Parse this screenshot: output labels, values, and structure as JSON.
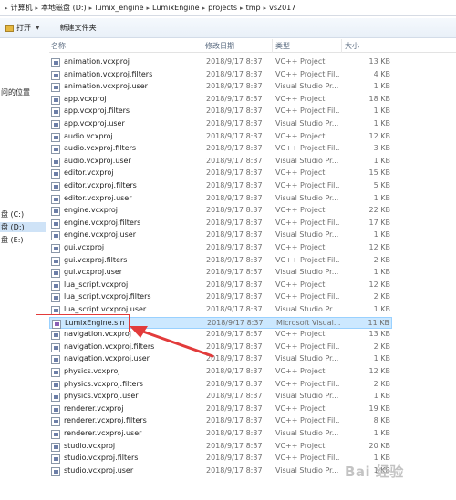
{
  "breadcrumb": [
    "计算机",
    "本地磁盘 (D:)",
    "lumix_engine",
    "LumixEngine",
    "projects",
    "tmp",
    "vs2017"
  ],
  "toolbar": {
    "open_label": "打开",
    "new_folder_label": "新建文件夹"
  },
  "nav": {
    "location_label": "问的位置",
    "drive_c": "盘 (C:)",
    "drive_d": "盘 (D:)",
    "drive_e": "盘 (E:)"
  },
  "columns": {
    "name": "名称",
    "date": "修改日期",
    "type": "类型",
    "size": "大小"
  },
  "files": [
    {
      "name": "animation.vcxproj",
      "date": "2018/9/17 8:37",
      "type": "VC++ Project",
      "size": "13 KB"
    },
    {
      "name": "animation.vcxproj.filters",
      "date": "2018/9/17 8:37",
      "type": "VC++ Project Fil...",
      "size": "4 KB"
    },
    {
      "name": "animation.vcxproj.user",
      "date": "2018/9/17 8:37",
      "type": "Visual Studio Pr...",
      "size": "1 KB"
    },
    {
      "name": "app.vcxproj",
      "date": "2018/9/17 8:37",
      "type": "VC++ Project",
      "size": "18 KB"
    },
    {
      "name": "app.vcxproj.filters",
      "date": "2018/9/17 8:37",
      "type": "VC++ Project Fil...",
      "size": "1 KB"
    },
    {
      "name": "app.vcxproj.user",
      "date": "2018/9/17 8:37",
      "type": "Visual Studio Pr...",
      "size": "1 KB"
    },
    {
      "name": "audio.vcxproj",
      "date": "2018/9/17 8:37",
      "type": "VC++ Project",
      "size": "12 KB"
    },
    {
      "name": "audio.vcxproj.filters",
      "date": "2018/9/17 8:37",
      "type": "VC++ Project Fil...",
      "size": "3 KB"
    },
    {
      "name": "audio.vcxproj.user",
      "date": "2018/9/17 8:37",
      "type": "Visual Studio Pr...",
      "size": "1 KB"
    },
    {
      "name": "editor.vcxproj",
      "date": "2018/9/17 8:37",
      "type": "VC++ Project",
      "size": "15 KB"
    },
    {
      "name": "editor.vcxproj.filters",
      "date": "2018/9/17 8:37",
      "type": "VC++ Project Fil...",
      "size": "5 KB"
    },
    {
      "name": "editor.vcxproj.user",
      "date": "2018/9/17 8:37",
      "type": "Visual Studio Pr...",
      "size": "1 KB"
    },
    {
      "name": "engine.vcxproj",
      "date": "2018/9/17 8:37",
      "type": "VC++ Project",
      "size": "22 KB"
    },
    {
      "name": "engine.vcxproj.filters",
      "date": "2018/9/17 8:37",
      "type": "VC++ Project Fil...",
      "size": "17 KB"
    },
    {
      "name": "engine.vcxproj.user",
      "date": "2018/9/17 8:37",
      "type": "Visual Studio Pr...",
      "size": "1 KB"
    },
    {
      "name": "gui.vcxproj",
      "date": "2018/9/17 8:37",
      "type": "VC++ Project",
      "size": "12 KB"
    },
    {
      "name": "gui.vcxproj.filters",
      "date": "2018/9/17 8:37",
      "type": "VC++ Project Fil...",
      "size": "2 KB"
    },
    {
      "name": "gui.vcxproj.user",
      "date": "2018/9/17 8:37",
      "type": "Visual Studio Pr...",
      "size": "1 KB"
    },
    {
      "name": "lua_script.vcxproj",
      "date": "2018/9/17 8:37",
      "type": "VC++ Project",
      "size": "12 KB"
    },
    {
      "name": "lua_script.vcxproj.filters",
      "date": "2018/9/17 8:37",
      "type": "VC++ Project Fil...",
      "size": "2 KB"
    },
    {
      "name": "lua_script.vcxproj.user",
      "date": "2018/9/17 8:37",
      "type": "Visual Studio Pr...",
      "size": "1 KB"
    },
    {
      "name": "LumixEngine.sln",
      "date": "2018/9/17 8:37",
      "type": "Microsoft Visual...",
      "size": "11 KB"
    },
    {
      "name": "navigation.vcxproj",
      "date": "2018/9/17 8:37",
      "type": "VC++ Project",
      "size": "13 KB"
    },
    {
      "name": "navigation.vcxproj.filters",
      "date": "2018/9/17 8:37",
      "type": "VC++ Project Fil...",
      "size": "2 KB"
    },
    {
      "name": "navigation.vcxproj.user",
      "date": "2018/9/17 8:37",
      "type": "Visual Studio Pr...",
      "size": "1 KB"
    },
    {
      "name": "physics.vcxproj",
      "date": "2018/9/17 8:37",
      "type": "VC++ Project",
      "size": "12 KB"
    },
    {
      "name": "physics.vcxproj.filters",
      "date": "2018/9/17 8:37",
      "type": "VC++ Project Fil...",
      "size": "2 KB"
    },
    {
      "name": "physics.vcxproj.user",
      "date": "2018/9/17 8:37",
      "type": "Visual Studio Pr...",
      "size": "1 KB"
    },
    {
      "name": "renderer.vcxproj",
      "date": "2018/9/17 8:37",
      "type": "VC++ Project",
      "size": "19 KB"
    },
    {
      "name": "renderer.vcxproj.filters",
      "date": "2018/9/17 8:37",
      "type": "VC++ Project Fil...",
      "size": "8 KB"
    },
    {
      "name": "renderer.vcxproj.user",
      "date": "2018/9/17 8:37",
      "type": "Visual Studio Pr...",
      "size": "1 KB"
    },
    {
      "name": "studio.vcxproj",
      "date": "2018/9/17 8:37",
      "type": "VC++ Project",
      "size": "20 KB"
    },
    {
      "name": "studio.vcxproj.filters",
      "date": "2018/9/17 8:37",
      "type": "VC++ Project Fil...",
      "size": "1 KB"
    },
    {
      "name": "studio.vcxproj.user",
      "date": "2018/9/17 8:37",
      "type": "Visual Studio Pr...",
      "size": "1 KB"
    }
  ],
  "selected_index": 21,
  "annotation_color": "#e23b3b",
  "watermark": "Bai 经验"
}
